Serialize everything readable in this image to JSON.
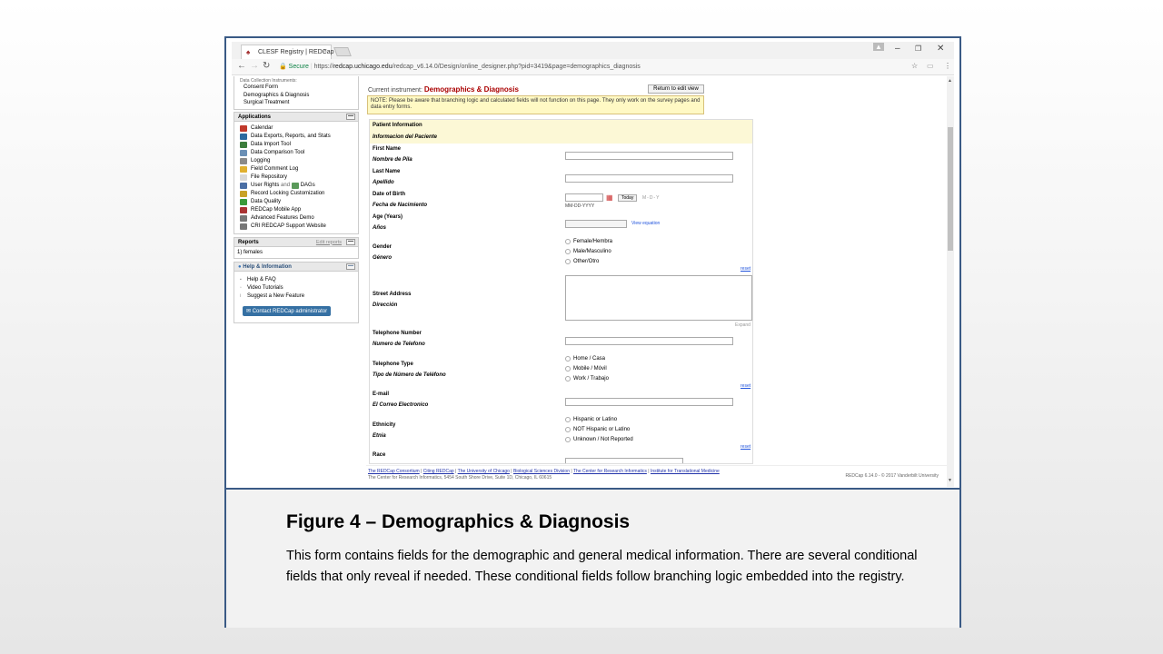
{
  "browser": {
    "tab_title": "CLESF Registry | REDCap",
    "tab_close": "×",
    "secure_label": "Secure",
    "url_prefix": "https://",
    "url_host": "redcap.uchicago.edu",
    "url_path": "/redcap_v6.14.0/Design/online_designer.php?pid=3419&page=demographics_diagnosis"
  },
  "sidebar": {
    "dci_caption": "Data Collection Instruments:",
    "instruments": [
      "Consent Form",
      "Demographics & Diagnosis",
      "Surgical Treatment"
    ],
    "applications_header": "Applications",
    "applications": [
      {
        "label": "Calendar",
        "icon": "calendar-icon",
        "color": "#c0392b"
      },
      {
        "label": "Data Exports, Reports, and Stats",
        "icon": "export-icon",
        "color": "#2c6ba0"
      },
      {
        "label": "Data Import Tool",
        "icon": "import-icon",
        "color": "#3c7d3c"
      },
      {
        "label": "Data Comparison Tool",
        "icon": "compare-icon",
        "color": "#6a8fb5"
      },
      {
        "label": "Logging",
        "icon": "logging-icon",
        "color": "#8a8a8a"
      },
      {
        "label": "Field Comment Log",
        "icon": "comment-icon",
        "color": "#e0b030"
      },
      {
        "label": "File Repository",
        "icon": "file-icon",
        "color": "#d9d9d9"
      },
      {
        "label": "User Rights",
        "icon": "user-icon",
        "color": "#4a6fa5"
      },
      {
        "label": "Record Locking Customization",
        "icon": "lock-icon",
        "color": "#c9a227"
      },
      {
        "label": "Data Quality",
        "icon": "quality-icon",
        "color": "#3a9a3a"
      },
      {
        "label": "REDCap Mobile App",
        "icon": "mobile-icon",
        "color": "#a33"
      },
      {
        "label": "Advanced Features Demo",
        "icon": "demo-icon",
        "color": "#777"
      },
      {
        "label": "CRI REDCAP Support Website",
        "icon": "web-icon",
        "color": "#777"
      }
    ],
    "user_rights_and": "and",
    "dags": "DAGs",
    "reports_header": "Reports",
    "edit_reports": "Edit reports",
    "reports": [
      "1) females"
    ],
    "help_header": "Help & Information",
    "help_items": [
      "Help & FAQ",
      "Video Tutorials",
      "Suggest a New Feature"
    ],
    "contact_button": "Contact REDCap administrator",
    "collapse": "—"
  },
  "main": {
    "current_instrument_label": "Current instrument:",
    "current_instrument": "Demographics & Diagnosis",
    "return_button": "Return to edit view",
    "note": "NOTE: Please be aware that branching logic and calculated fields will not function on this page. They only work on the survey pages and data entry forms.",
    "section_title": "Patient Information",
    "section_title_es": "Informacion del Paciente",
    "fields": {
      "first_name": "First Name",
      "first_name_es": "Nombre de Pila",
      "last_name": "Last Name",
      "last_name_es": "Apellido",
      "dob": "Date of Birth",
      "dob_es": "Fecha de Nacimiento",
      "today_button": "Today",
      "dob_format": "M-D-Y",
      "dob_hint": "MM-DD-YYYY",
      "age": "Age (Years)",
      "age_es": "Años",
      "view_equation": "View equation",
      "gender": "Gender",
      "gender_es": "Género",
      "gender_options": [
        "Female/Hembra",
        "Male/Masculino",
        "Other/Otro"
      ],
      "street": "Street Address",
      "street_es": "Dirección",
      "expand": "Expand",
      "phone": "Telephone Number",
      "phone_es": "Numero de Telefono",
      "phone_type": "Telephone Type",
      "phone_type_es": "Tipo de Número de Teléfono",
      "phone_type_options": [
        "Home / Casa",
        "Mobile / Móvil",
        "Work / Trabajo"
      ],
      "email": "E-mail",
      "email_es": "El Correo Electronico",
      "ethnicity": "Ethnicity",
      "ethnicity_es": "Etnia",
      "ethnicity_options": [
        "Hispanic or Latino",
        "NOT Hispanic or Latino",
        "Unknown / Not Reported"
      ],
      "race": "Race",
      "reset": "reset"
    }
  },
  "footer": {
    "links": [
      "The REDCap Consortium",
      "Citing REDCap",
      "The University of Chicago",
      "Biological Sciences Division",
      "The Center for Research Informatics",
      "Institute for Translational Medicine"
    ],
    "address": "The Center for Research Informatics, 5454 South Shore Drive, Suite 1D, Chicago, IL 60615",
    "version": "REDCap 6.14.0 - © 2017 Vanderbilt University"
  },
  "caption": {
    "title": "Figure 4 – Demographics & Diagnosis",
    "body": "This form contains fields  for the demographic and general medical information. There are several conditional fields that only reveal if needed. These conditional fields follow branching logic embedded into the registry."
  }
}
